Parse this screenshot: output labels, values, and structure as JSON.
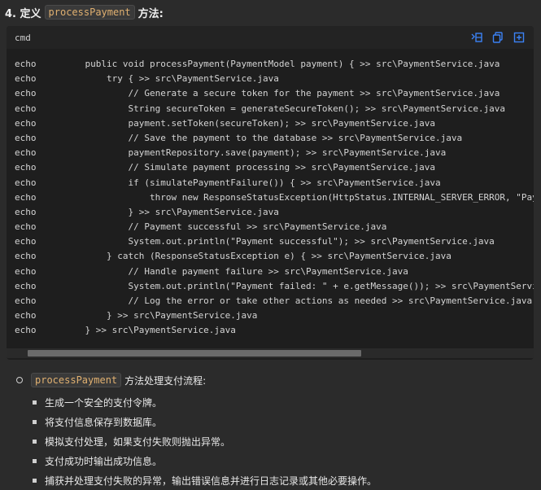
{
  "heading": {
    "prefix": "4. 定义",
    "method": "processPayment",
    "suffix": "方法:"
  },
  "codeblock": {
    "language": "cmd",
    "actions": [
      "wrap-icon",
      "copy-icon",
      "expand-icon"
    ],
    "lines": [
      {
        "cmd": "echo",
        "code": "    public void processPayment(PaymentModel payment) { >> src\\PaymentService.java"
      },
      {
        "cmd": "echo",
        "code": "        try { >> src\\PaymentService.java"
      },
      {
        "cmd": "echo",
        "code": "            // Generate a secure token for the payment >> src\\PaymentService.java"
      },
      {
        "cmd": "echo",
        "code": "            String secureToken = generateSecureToken(); >> src\\PaymentService.java"
      },
      {
        "cmd": "echo",
        "code": "            payment.setToken(secureToken); >> src\\PaymentService.java"
      },
      {
        "cmd": "echo",
        "code": "            // Save the payment to the database >> src\\PaymentService.java"
      },
      {
        "cmd": "echo",
        "code": "            paymentRepository.save(payment); >> src\\PaymentService.java"
      },
      {
        "cmd": "echo",
        "code": "            // Simulate payment processing >> src\\PaymentService.java"
      },
      {
        "cmd": "echo",
        "code": "            if (simulatePaymentFailure()) { >> src\\PaymentService.java"
      },
      {
        "cmd": "echo",
        "code": "                throw new ResponseStatusException(HttpStatus.INTERNAL_SERVER_ERROR, \"Paym"
      },
      {
        "cmd": "echo",
        "code": "            } >> src\\PaymentService.java"
      },
      {
        "cmd": "echo",
        "code": "            // Payment successful >> src\\PaymentService.java"
      },
      {
        "cmd": "echo",
        "code": "            System.out.println(\"Payment successful\"); >> src\\PaymentService.java"
      },
      {
        "cmd": "echo",
        "code": "        } catch (ResponseStatusException e) { >> src\\PaymentService.java"
      },
      {
        "cmd": "echo",
        "code": "            // Handle payment failure >> src\\PaymentService.java"
      },
      {
        "cmd": "echo",
        "code": "            System.out.println(\"Payment failed: \" + e.getMessage()); >> src\\PaymentServic"
      },
      {
        "cmd": "echo",
        "code": "            // Log the error or take other actions as needed >> src\\PaymentService.java"
      },
      {
        "cmd": "echo",
        "code": "        } >> src\\PaymentService.java"
      },
      {
        "cmd": "echo",
        "code": "    } >> src\\PaymentService.java"
      }
    ]
  },
  "summary": {
    "method": "processPayment",
    "title_suffix": "方法处理支付流程:",
    "points": [
      "生成一个安全的支付令牌。",
      "将支付信息保存到数据库。",
      "模拟支付处理，如果支付失败则抛出异常。",
      "支付成功时输出成功信息。",
      "捕获并处理支付失败的异常，输出错误信息并进行日志记录或其他必要操作。"
    ]
  }
}
